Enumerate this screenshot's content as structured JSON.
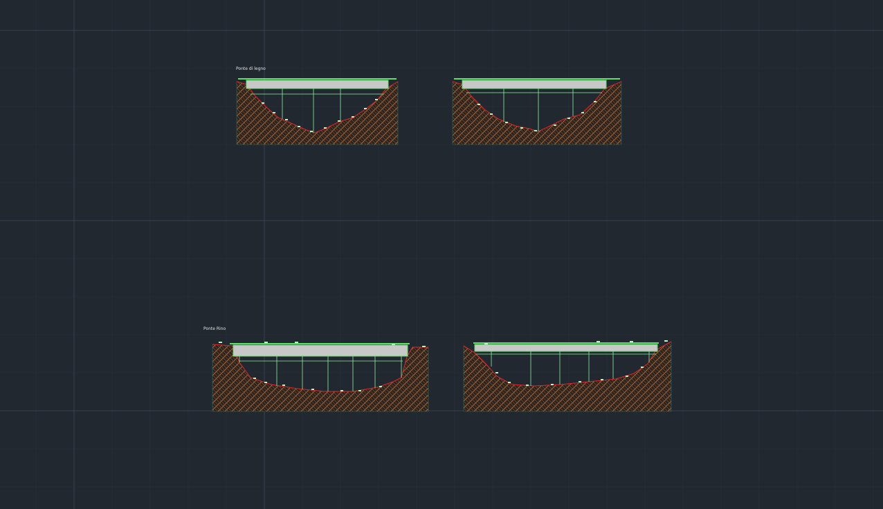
{
  "labels": {
    "top": "Ponte di legno",
    "bottom": "Ponte Rino"
  },
  "colors": {
    "background": "#212830",
    "grid_major": "#37414f",
    "grid_minor": "#2a323d",
    "deck_outline": "#5fe06a",
    "deck_fill": "#c8c8c8",
    "ground_profile": "#e0242a",
    "soil_hatch_a": "#c46a2a",
    "soil_hatch_b": "#6b3a1a",
    "soil_base": "#2a2420",
    "piers": "#8ff0a0",
    "markers": "#b8f5c2",
    "label_text": "#e6e6e6"
  }
}
